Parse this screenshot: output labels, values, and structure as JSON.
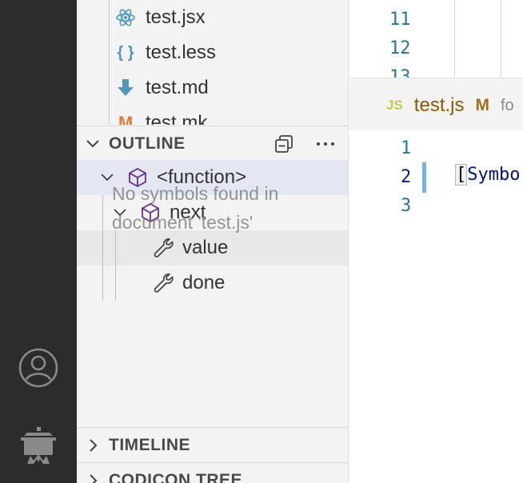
{
  "activity_bar": {
    "icons": [
      "account-icon",
      "cooking-pot-icon"
    ]
  },
  "explorer": {
    "files": [
      {
        "name": "test.jsx",
        "icon": "react-icon"
      },
      {
        "name": "test.less",
        "icon": "braces-icon",
        "glyph": "{ }"
      },
      {
        "name": "test.md",
        "icon": "markdown-arrow-icon"
      },
      {
        "name": "test.mk",
        "icon": "makefile-icon",
        "glyph": "M"
      }
    ]
  },
  "outline": {
    "title": "OUTLINE",
    "empty_message": "No symbols found in document 'test.js'",
    "tree": [
      {
        "label": "<function>",
        "kind": "cube-icon"
      },
      {
        "label": "next",
        "kind": "cube-icon"
      },
      {
        "label": "value",
        "kind": "wrench-icon"
      },
      {
        "label": "done",
        "kind": "wrench-icon"
      }
    ]
  },
  "panels": {
    "timeline": "TIMELINE",
    "codicon_tree": "CODICON TREE"
  },
  "editor_top": {
    "line_numbers": [
      "11",
      "12",
      "13"
    ]
  },
  "tab": {
    "badge": "JS",
    "filename": "test.js",
    "modified": "M",
    "path_fragment": "fo"
  },
  "editor": {
    "line_numbers": [
      "1",
      "2",
      "3"
    ],
    "line2_bracket": "[",
    "line2_text": "Symbo"
  },
  "colors": {
    "activity_bar": "#2c2c2c",
    "sidebar": "#f3f3f3",
    "selected_row": "#e4e6f1",
    "line_number": "#237893",
    "symbol_purple": "#652d90",
    "modified_indicator": "#75b3e2"
  }
}
